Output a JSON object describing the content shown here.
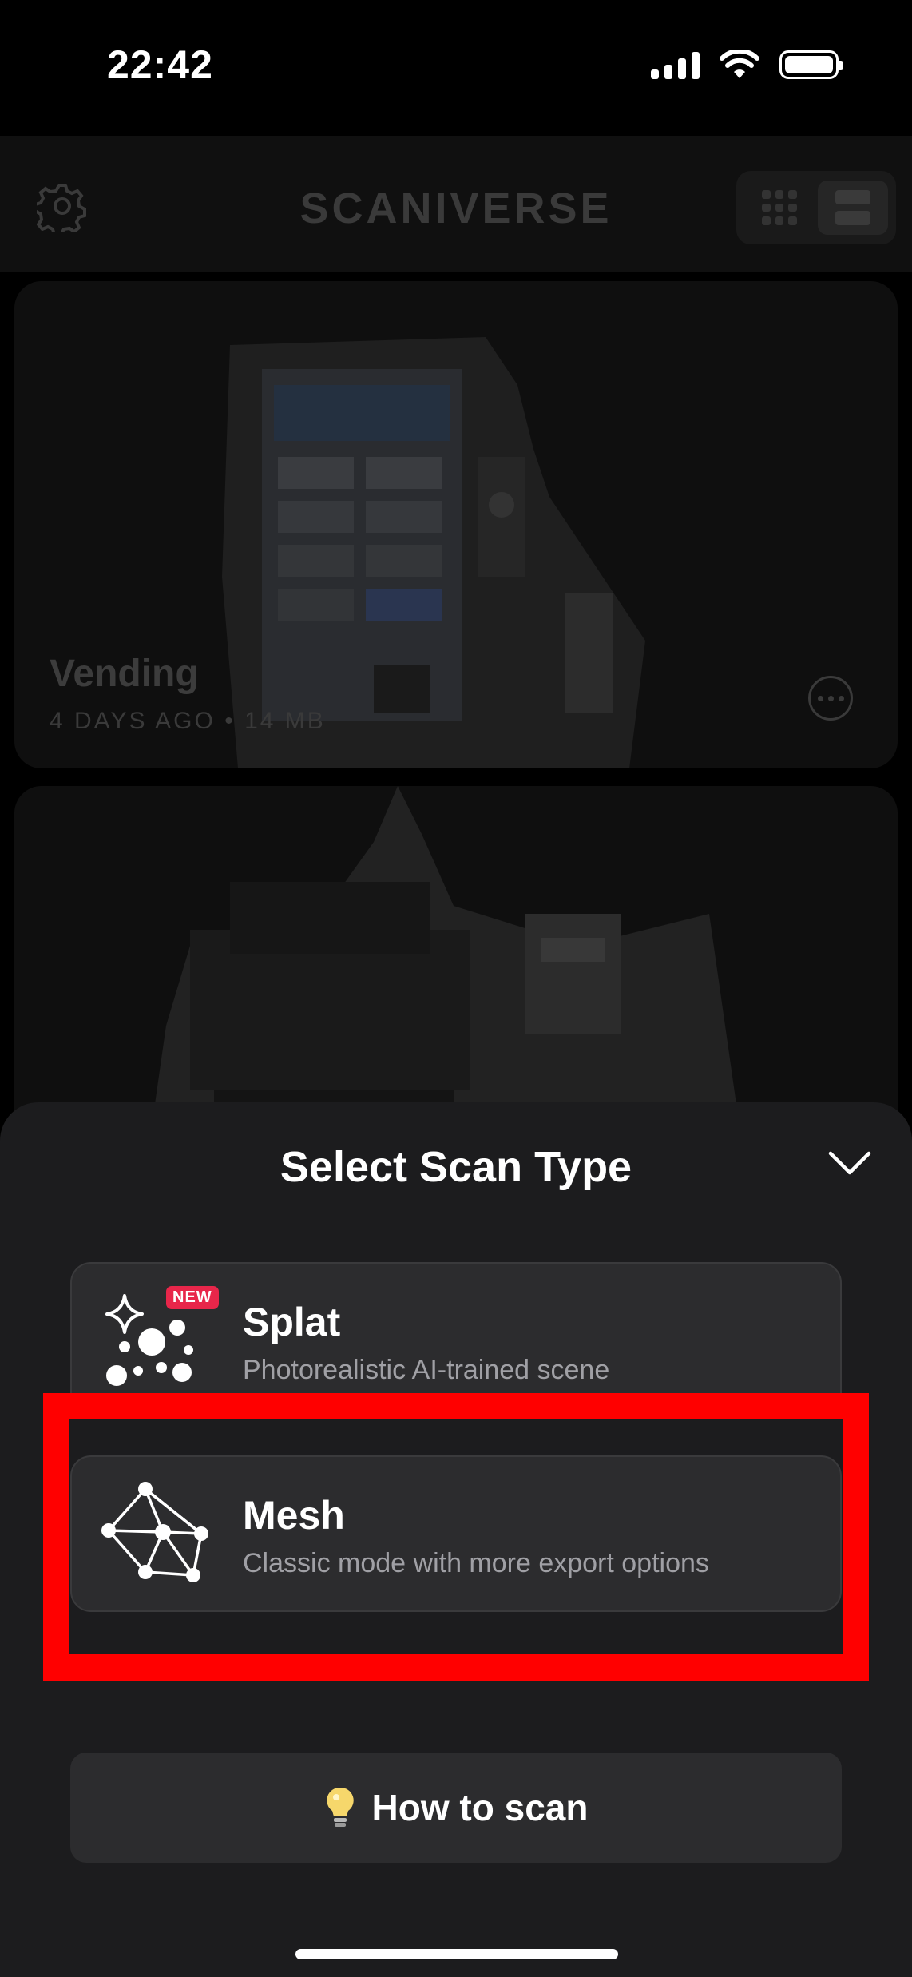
{
  "status_bar": {
    "time": "22:42"
  },
  "header": {
    "title": "SCANIVERSE"
  },
  "scans": [
    {
      "title": "Vending",
      "age": "4 DAYS AGO",
      "separator": "•",
      "size": "14 MB"
    }
  ],
  "sheet": {
    "title": "Select Scan Type",
    "options": [
      {
        "title": "Splat",
        "subtitle": "Photorealistic AI-trained scene",
        "badge": "NEW"
      },
      {
        "title": "Mesh",
        "subtitle": "Classic mode with more export options"
      }
    ],
    "how_to_label": "How to scan"
  },
  "colors": {
    "background": "#000000",
    "sheet": "#1c1c1e",
    "option_bg": "#2c2c2e",
    "badge": "#e8264a",
    "highlight": "#ff0000"
  },
  "icons": [
    "settings-gear-icon",
    "grid-view-icon",
    "list-view-icon",
    "more-options-icon",
    "chevron-down-icon",
    "sparkle-dots-icon",
    "mesh-network-icon",
    "lightbulb-icon"
  ]
}
